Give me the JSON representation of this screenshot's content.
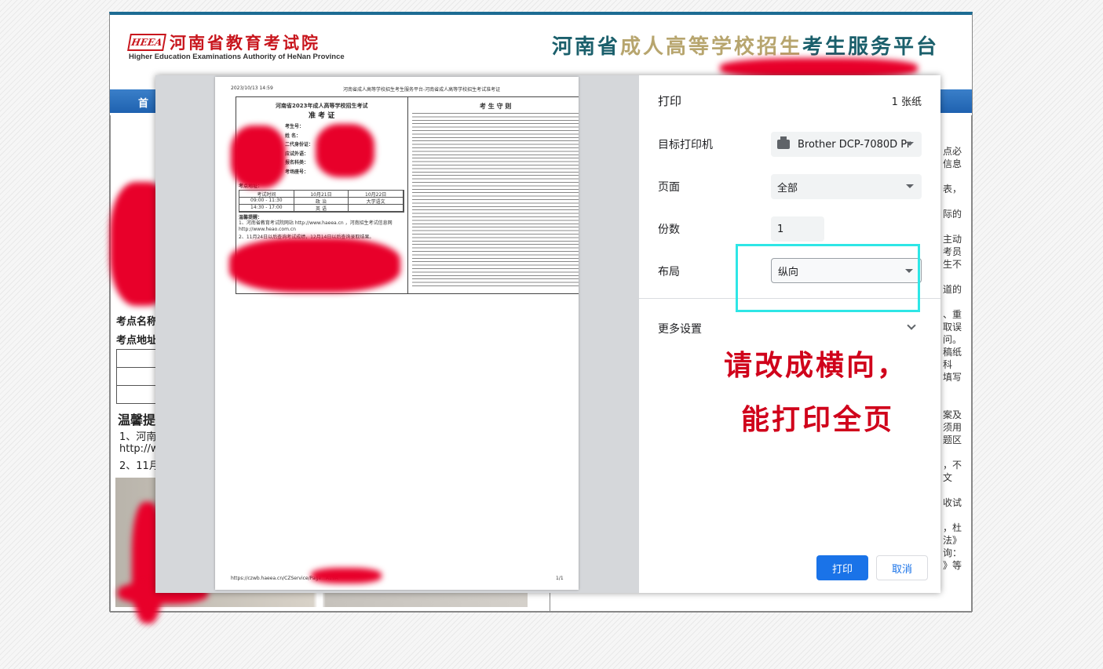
{
  "site": {
    "logo_text": "HEEA",
    "org_cn": "河南省教育考试院",
    "org_en": "Higher Education Examinations Authority of HeNan Province",
    "platform_part1": "河南省",
    "platform_part2": "成人高等学校招生",
    "platform_part3": "考生服务平台",
    "nav_home": "首",
    "exam_site_name": "考点名称",
    "exam_site_addr": "考点地址",
    "tips_title": "温馨提",
    "tip1": "1、河南",
    "tip2": "http://wv",
    "tip3": "2、11月",
    "right_fragments": [
      "点必",
      "信息",
      "表，",
      "际的",
      "主动",
      "考员",
      "生不",
      "道的",
      "、重",
      "取误",
      "问。",
      "稿纸",
      "科",
      "填写",
      "案及",
      "须用",
      "题区",
      "，不",
      "文",
      "收试",
      "，杜",
      "法》",
      "询：",
      "》等"
    ]
  },
  "preview": {
    "timestamp": "2023/10/13 14:59",
    "page_header": "河南省成人高等学校招生考生服务平台-河南省成人高等学校招生考试准考证",
    "card_title": "河南省2023年成人高等学校招生考试",
    "card_subtitle": "准 考 证",
    "fields": [
      "考生号：",
      "姓 名：",
      "二代身份证：",
      "应试外语：",
      "报名科类：",
      "考场座号："
    ],
    "site_label": "考点地址：",
    "schedule_header": [
      "考试时间",
      "10月21日",
      "10月22日"
    ],
    "schedule_rows": [
      [
        "09:00 - 11:30",
        "政 治",
        "大学语文"
      ],
      [
        "14:30 - 17:00",
        "英 语",
        ""
      ]
    ],
    "tips_title": "温馨提醒：",
    "tip1": "1、河南省教育考试院网站 http://www.haeea.cn ，河南招生考试信息网 http://www.heao.com.cn",
    "tip2": "2、11月24日以后查询考试成绩，12月14日以后查询录取结果。",
    "rules_title": "考 生 守 则",
    "footer_url": "https://czwb.haeea.cn/CZService/Page...A19A",
    "footer_page": "1/1"
  },
  "dialog": {
    "title": "打印",
    "sheet_count": "1 张纸",
    "dest_label": "目标打印机",
    "dest_value": "Brother DCP-7080D Pr",
    "pages_label": "页面",
    "pages_value": "全部",
    "copies_label": "份数",
    "copies_value": "1",
    "layout_label": "布局",
    "layout_value": "纵向",
    "more_settings": "更多设置",
    "print_button": "打印",
    "cancel_button": "取消"
  },
  "annotation": {
    "line1": "请改成横向，",
    "line2": "能打印全页",
    "color": "#d0021b",
    "highlight_color": "#2ee6e6"
  }
}
